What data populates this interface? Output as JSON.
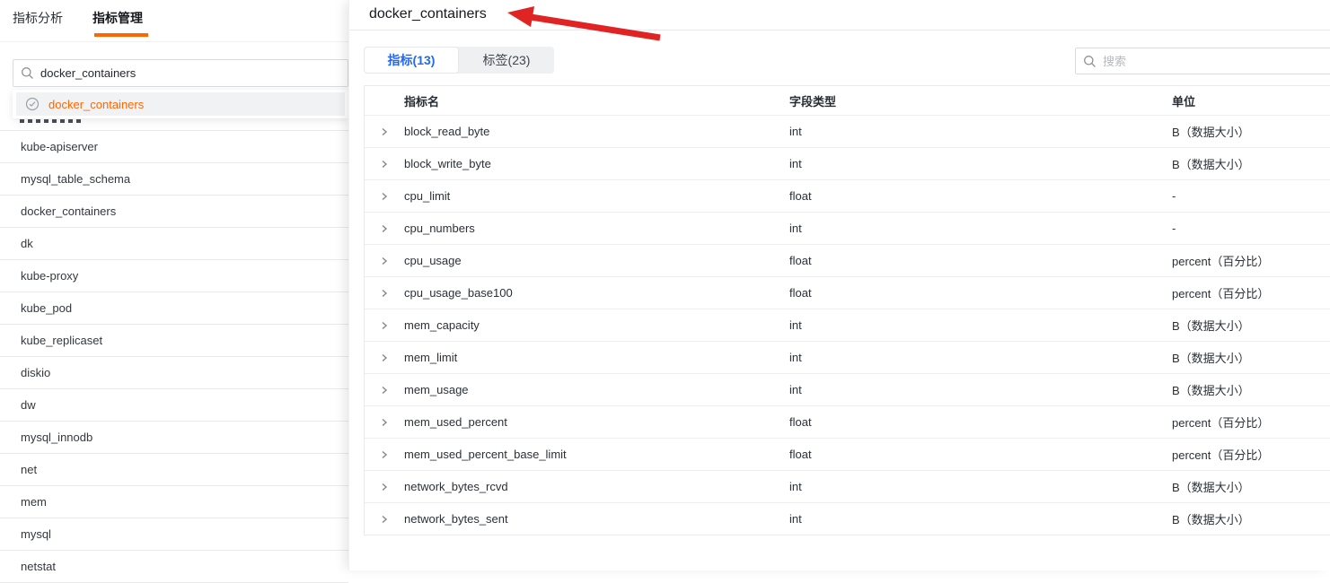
{
  "left_panel": {
    "tabs": [
      {
        "label": "指标分析",
        "active": false
      },
      {
        "label": "指标管理",
        "active": true
      }
    ],
    "search": {
      "value": "docker_containers"
    },
    "suggestion": {
      "label": "docker_containers",
      "icon": "gauge-icon"
    },
    "list": [
      "kube-apiserver",
      "mysql_table_schema",
      "docker_containers",
      "dk",
      "kube-proxy",
      "kube_pod",
      "kube_replicaset",
      "diskio",
      "dw",
      "mysql_innodb",
      "net",
      "mem",
      "mysql",
      "netstat"
    ]
  },
  "drawer": {
    "title": "docker_containers",
    "tabs": [
      {
        "label": "指标(13)",
        "active": true
      },
      {
        "label": "标签(23)",
        "active": false
      }
    ],
    "search": {
      "placeholder": "搜索"
    },
    "table": {
      "columns": [
        "指标名",
        "字段类型",
        "单位"
      ],
      "rows": [
        [
          "block_read_byte",
          "int",
          "B（数据大小）"
        ],
        [
          "block_write_byte",
          "int",
          "B（数据大小）"
        ],
        [
          "cpu_limit",
          "float",
          "-"
        ],
        [
          "cpu_numbers",
          "int",
          "-"
        ],
        [
          "cpu_usage",
          "float",
          "percent（百分比）"
        ],
        [
          "cpu_usage_base100",
          "float",
          "percent（百分比）"
        ],
        [
          "mem_capacity",
          "int",
          "B（数据大小）"
        ],
        [
          "mem_limit",
          "int",
          "B（数据大小）"
        ],
        [
          "mem_usage",
          "int",
          "B（数据大小）"
        ],
        [
          "mem_used_percent",
          "float",
          "percent（百分比）"
        ],
        [
          "mem_used_percent_base_limit",
          "float",
          "percent（百分比）"
        ],
        [
          "network_bytes_rcvd",
          "int",
          "B（数据大小）"
        ],
        [
          "network_bytes_sent",
          "int",
          "B（数据大小）"
        ]
      ]
    }
  },
  "annotation": {
    "type": "red-arrow-pointing-at-title"
  },
  "colors": {
    "accent_orange": "#ff6600",
    "active_tab_blue": "#2468f2",
    "suggestion_text_orange": "#ff6600",
    "arrow_red": "#e02424"
  }
}
